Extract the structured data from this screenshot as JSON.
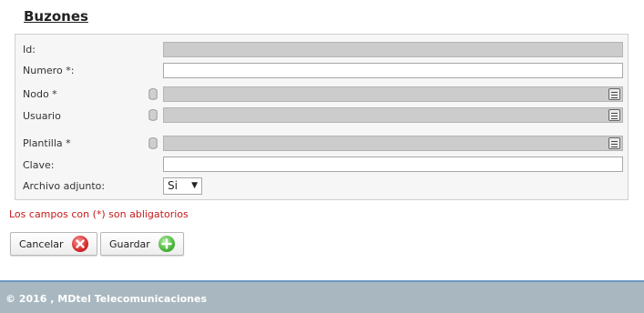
{
  "page": {
    "title": "Buzones"
  },
  "form": {
    "id_label": "Id:",
    "id_value": "",
    "numero_label": "Numero *:",
    "numero_value": "",
    "nodo_label": "Nodo *",
    "nodo_value": "",
    "usuario_label": "Usuario",
    "usuario_value": "",
    "plantilla_label": "Plantilla *",
    "plantilla_value": "",
    "clave_label": "Clave:",
    "clave_value": "",
    "archivo_label": "Archivo adjunto:",
    "archivo_value": "Si",
    "lookup_icon": "database-icon",
    "list_icon": "list-icon"
  },
  "required_note": "Los campos con (*) son abligatorios",
  "buttons": {
    "cancel_label": "Cancelar",
    "cancel_icon": "close-circle-icon",
    "save_label": "Guardar",
    "save_icon": "plus-circle-icon"
  },
  "footer": {
    "text": "© 2016 , MDtel Telecomunicaciones"
  },
  "colors": {
    "required_note": "#c41a1a",
    "footer_bg": "#a9b8c0",
    "footer_border": "#6d98c2",
    "readonly_field": "#cccccc"
  }
}
